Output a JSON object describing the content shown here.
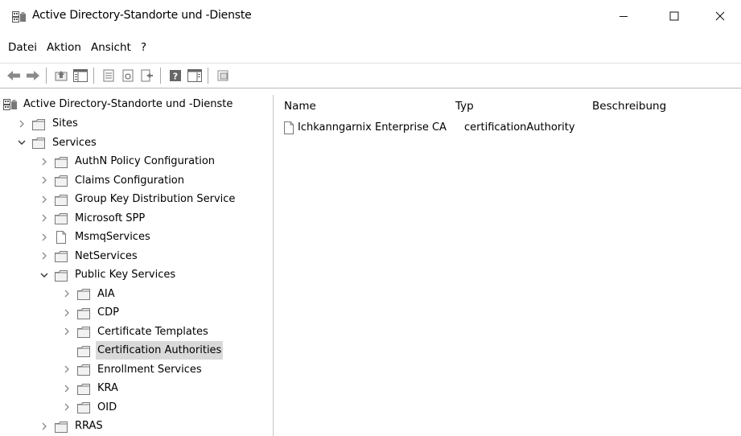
{
  "window": {
    "title": "Active Directory-Standorte und -Dienste",
    "minimize_glyph": "—",
    "maximize_glyph": "☐",
    "close_glyph": "✕"
  },
  "menu": [
    "Datei",
    "Aktion",
    "Ansicht",
    "?"
  ],
  "toolbar": {
    "icons": [
      "back-arrow-icon",
      "forward-arrow-icon",
      "up-folder-icon",
      "show-hide-console-tree-icon",
      "properties-icon",
      "refresh-icon",
      "export-list-icon",
      "help-icon",
      "show-hide-action-pane-icon",
      "new-window-icon"
    ]
  },
  "tree": {
    "root": "Active Directory-Standorte und -Dienste",
    "items": [
      {
        "label": "Sites",
        "level": 1,
        "expander": "collapsed"
      },
      {
        "label": "Services",
        "level": 1,
        "expander": "expanded"
      },
      {
        "label": "AuthN Policy Configuration",
        "level": 2,
        "expander": "collapsed"
      },
      {
        "label": "Claims Configuration",
        "level": 2,
        "expander": "collapsed"
      },
      {
        "label": "Group Key Distribution Service",
        "level": 2,
        "expander": "collapsed"
      },
      {
        "label": "Microsoft SPP",
        "level": 2,
        "expander": "collapsed"
      },
      {
        "label": "MsmqServices",
        "level": 2,
        "expander": "collapsed",
        "icon": "page"
      },
      {
        "label": "NetServices",
        "level": 2,
        "expander": "collapsed"
      },
      {
        "label": "Public Key Services",
        "level": 2,
        "expander": "expanded"
      },
      {
        "label": "AIA",
        "level": 3,
        "expander": "collapsed"
      },
      {
        "label": "CDP",
        "level": 3,
        "expander": "collapsed"
      },
      {
        "label": "Certificate Templates",
        "level": 3,
        "expander": "collapsed"
      },
      {
        "label": "Certification Authorities",
        "level": 3,
        "expander": "none",
        "selected": true
      },
      {
        "label": "Enrollment Services",
        "level": 3,
        "expander": "collapsed"
      },
      {
        "label": "KRA",
        "level": 3,
        "expander": "collapsed"
      },
      {
        "label": "OID",
        "level": 3,
        "expander": "collapsed"
      },
      {
        "label": "RRAS",
        "level": 2,
        "expander": "collapsed"
      }
    ]
  },
  "list": {
    "columns": [
      "Name",
      "Typ",
      "Beschreibung"
    ],
    "rows": [
      {
        "name": "Ichkanngarnix Enterprise CA",
        "type": "certificationAuthority",
        "description": ""
      }
    ]
  },
  "colors": {
    "selection": "#d9d9d9",
    "separator": "#c8c8c8",
    "folder": "#f2f2f2"
  }
}
